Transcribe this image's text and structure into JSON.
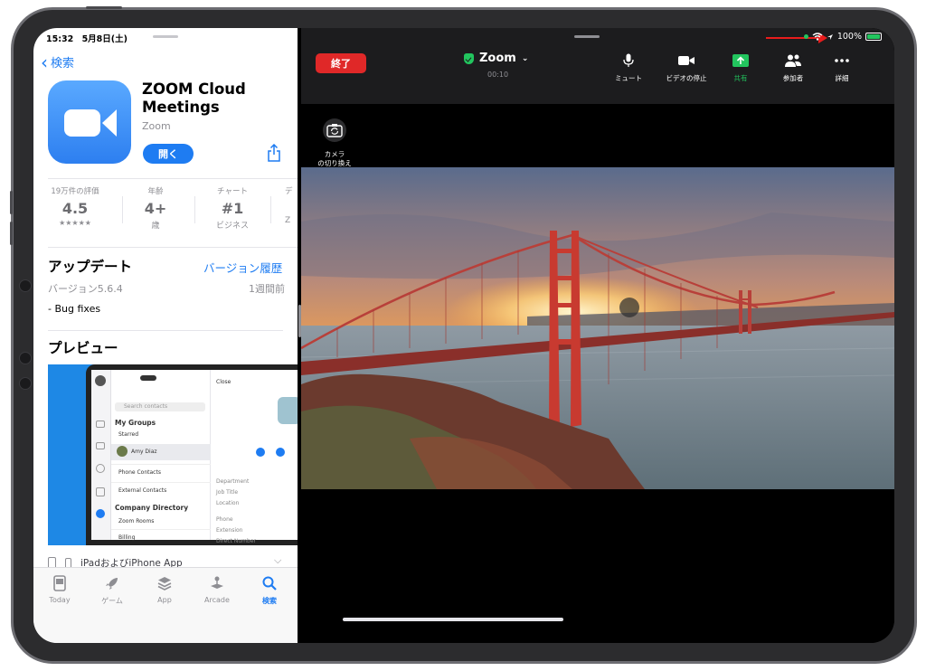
{
  "app_store": {
    "status_time": "15:32",
    "status_date": "5月8日(土)",
    "back_label": "検索",
    "app_name": "ZOOM Cloud Meetings",
    "developer": "Zoom",
    "open_button": "開く",
    "stats": [
      {
        "caption": "19万件の評価",
        "value": "4.5",
        "sub": "★★★★★"
      },
      {
        "caption": "年齢",
        "value": "4+",
        "sub": "歳"
      },
      {
        "caption": "チャート",
        "value": "#1",
        "sub": "ビジネス"
      },
      {
        "caption": "デ",
        "value": "",
        "sub": "Z"
      }
    ],
    "update_title": "アップデート",
    "version_history_link": "バージョン履歴",
    "version": "バージョン5.6.4",
    "updated_ago": "1週間前",
    "release_notes": "- Bug fixes",
    "preview_title": "プレビュー",
    "preview_mock": {
      "header": "Close",
      "my_groups": "My Groups",
      "search_placeholder": "Search contacts",
      "starred": "Starred",
      "contact": "Amy Diaz",
      "phone_contacts": "Phone Contacts",
      "external_contacts": "External Contacts",
      "company_directory": "Company Directory",
      "zoom_rooms": "Zoom Rooms",
      "billing": "Billing",
      "department": "Department",
      "job_title": "Job Title",
      "location": "Location",
      "phone": "Phone",
      "extension": "Extension",
      "direct_number": "Direct Number"
    },
    "compatibility": "iPadおよびiPhone App",
    "tabs": [
      {
        "label": "Today",
        "icon": "today-icon"
      },
      {
        "label": "ゲーム",
        "icon": "rocket-icon"
      },
      {
        "label": "App",
        "icon": "layers-icon"
      },
      {
        "label": "Arcade",
        "icon": "arcade-icon"
      },
      {
        "label": "検索",
        "icon": "search-icon"
      }
    ],
    "active_tab": "検索"
  },
  "zoom": {
    "end_button": "終了",
    "meeting_title": "Zoom",
    "timer": "00:10",
    "controls": [
      {
        "label": "ミュート",
        "icon": "microphone-icon"
      },
      {
        "label": "ビデオの停止",
        "icon": "video-camera-icon"
      },
      {
        "label": "共有",
        "icon": "share-screen-icon"
      },
      {
        "label": "参加者",
        "icon": "participants-icon"
      },
      {
        "label": "詳細",
        "icon": "more-icon"
      }
    ],
    "camera_switch_label": "カメラ\nの切り換え",
    "battery": "100%",
    "video_content": "Golden Gate Bridge at sunset"
  },
  "colors": {
    "accent_blue": "#1e7cf2",
    "zoom_red": "#e02828",
    "zoom_green": "#22c55e"
  }
}
